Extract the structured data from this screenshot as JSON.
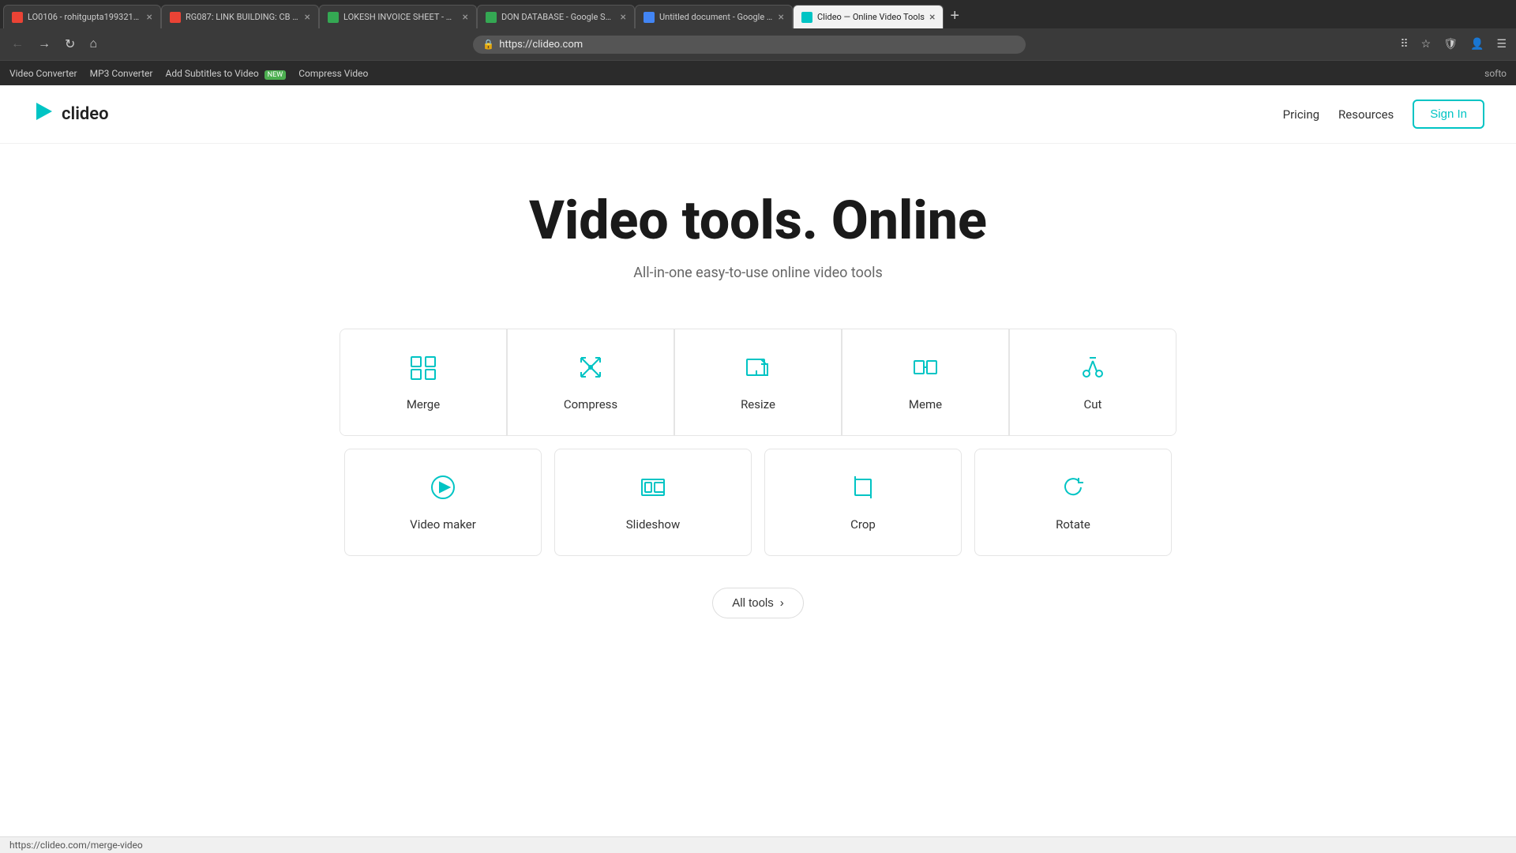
{
  "browser": {
    "tabs": [
      {
        "id": "tab1",
        "favicon_color": "#ea4335",
        "title": "LO0106 - rohitgupta199321©...",
        "active": false
      },
      {
        "id": "tab2",
        "favicon_color": "#ea4335",
        "title": "RG087: LINK BUILDING: CB N...",
        "active": false
      },
      {
        "id": "tab3",
        "favicon_color": "#34a853",
        "title": "LOKESH INVOICE SHEET - Go...",
        "active": false
      },
      {
        "id": "tab4",
        "favicon_color": "#34a853",
        "title": "DON DATABASE - Google She...",
        "active": false
      },
      {
        "id": "tab5",
        "favicon_color": "#4285f4",
        "title": "Untitled document - Google ...",
        "active": false
      },
      {
        "id": "tab6",
        "favicon_color": "#00c4c4",
        "title": "Clideo — Online Video Tools",
        "active": true
      }
    ],
    "url": "https://clideo.com",
    "toolbar_icons": [
      "extensions",
      "bookmark",
      "profile"
    ]
  },
  "bookmarks": [
    {
      "label": "Video Converter"
    },
    {
      "label": "MP3 Converter"
    },
    {
      "label": "Add Subtitles to Video",
      "badge": "NEW"
    },
    {
      "label": "Compress Video"
    }
  ],
  "brand": {
    "logo_text": "clideo",
    "softo_text": "softo"
  },
  "nav": {
    "pricing": "Pricing",
    "resources": "Resources",
    "signin": "Sign In"
  },
  "hero": {
    "title": "Video tools. Online",
    "subtitle": "All-in-one easy-to-use online video tools"
  },
  "tools_row1": [
    {
      "id": "merge",
      "label": "Merge"
    },
    {
      "id": "compress",
      "label": "Compress"
    },
    {
      "id": "resize",
      "label": "Resize"
    },
    {
      "id": "meme",
      "label": "Meme"
    },
    {
      "id": "cut",
      "label": "Cut"
    }
  ],
  "tools_row2": [
    {
      "id": "videomaker",
      "label": "Video maker"
    },
    {
      "id": "slideshow",
      "label": "Slideshow"
    },
    {
      "id": "crop",
      "label": "Crop"
    },
    {
      "id": "rotate",
      "label": "Rotate"
    }
  ],
  "all_tools_btn": "All tools",
  "status_url": "https://clideo.com/merge-video"
}
